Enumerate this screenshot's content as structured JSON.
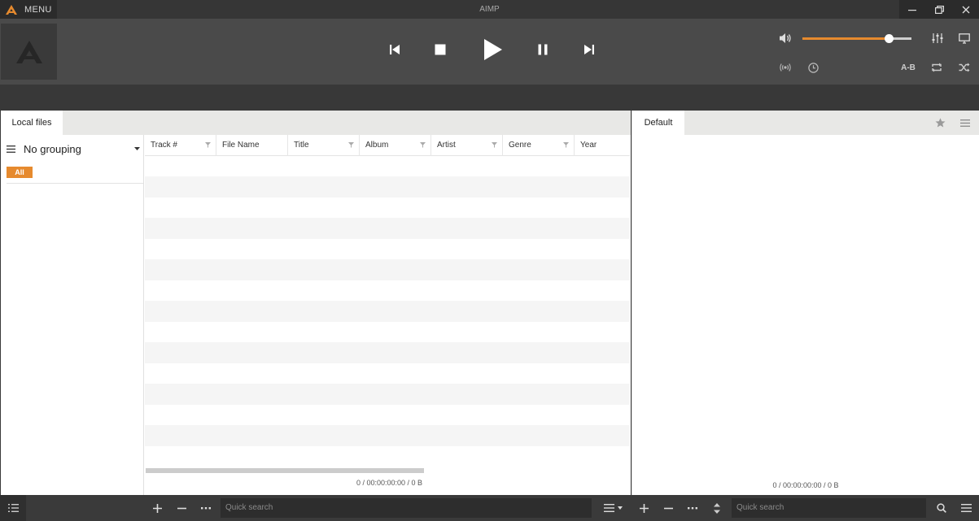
{
  "titlebar": {
    "menu_label": "MENU",
    "app_title": "AIMP"
  },
  "player": {
    "ab_label": "A-B",
    "volume_level": 0.79
  },
  "colors": {
    "accent": "#e68a2e",
    "dark_bg": "#4a4a4a",
    "titlebar_bg": "#363636"
  },
  "left_panel": {
    "tab_label": "Local files",
    "grouping_label": "No grouping",
    "all_badge": "All",
    "columns": [
      "Track #",
      "File Name",
      "Title",
      "Album",
      "Artist",
      "Genre",
      "Year"
    ],
    "status": "0 / 00:00:00:00 / 0 B"
  },
  "right_panel": {
    "tab_label": "Default",
    "status": "0 / 00:00:00:00 / 0 B"
  },
  "bottom": {
    "search_left_placeholder": "Quick search",
    "search_right_placeholder": "Quick search"
  }
}
